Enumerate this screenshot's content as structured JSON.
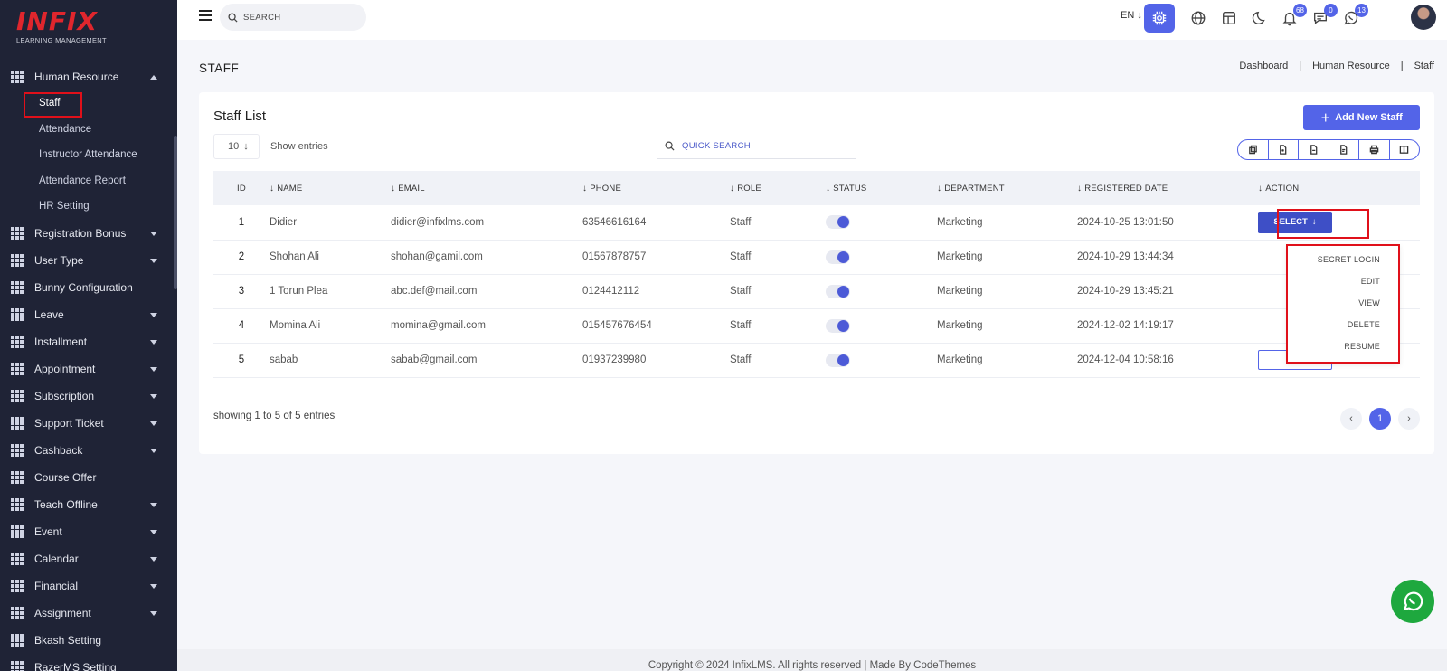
{
  "brand": {
    "logo_text": "INFIX",
    "logo_sub": "LEARNING MANAGEMENT"
  },
  "sidebar": {
    "section": {
      "label": "Human Resource"
    },
    "sub_items": [
      {
        "label": "Staff",
        "active": true
      },
      {
        "label": "Attendance"
      },
      {
        "label": "Instructor Attendance"
      },
      {
        "label": "Attendance Report"
      },
      {
        "label": "HR Setting"
      }
    ],
    "items": [
      {
        "label": "Registration Bonus",
        "caret": true
      },
      {
        "label": "User Type",
        "caret": true
      },
      {
        "label": "Bunny Configuration",
        "caret": false
      },
      {
        "label": "Leave",
        "caret": true
      },
      {
        "label": "Installment",
        "caret": true
      },
      {
        "label": "Appointment",
        "caret": true
      },
      {
        "label": "Subscription",
        "caret": true
      },
      {
        "label": "Support Ticket",
        "caret": true
      },
      {
        "label": "Cashback",
        "caret": true
      },
      {
        "label": "Course Offer",
        "caret": false
      },
      {
        "label": "Teach Offline",
        "caret": true
      },
      {
        "label": "Event",
        "caret": true
      },
      {
        "label": "Calendar",
        "caret": true
      },
      {
        "label": "Financial",
        "caret": true
      },
      {
        "label": "Assignment",
        "caret": true
      },
      {
        "label": "Bkash Setting",
        "caret": false
      },
      {
        "label": "RazerMS Setting",
        "caret": false
      }
    ]
  },
  "header": {
    "search_placeholder": "SEARCH",
    "language": "EN",
    "badges": {
      "notifications": "68",
      "messages": "0",
      "whatsapp": "13"
    }
  },
  "page": {
    "title": "STAFF",
    "breadcrumb": [
      "Dashboard",
      "Human Resource",
      "Staff"
    ]
  },
  "card": {
    "title": "Staff List",
    "add_button": "Add New Staff",
    "entries_value": "10",
    "entries_label": "Show entries",
    "quick_search_placeholder": "QUICK SEARCH"
  },
  "table": {
    "columns": [
      "ID",
      "NAME",
      "EMAIL",
      "PHONE",
      "ROLE",
      "STATUS",
      "DEPARTMENT",
      "REGISTERED DATE",
      "ACTION"
    ],
    "rows": [
      {
        "id": "1",
        "name": "Didier",
        "email": "didier@infixlms.com",
        "phone": "63546616164",
        "role": "Staff",
        "department": "Marketing",
        "date": "2024-10-25 13:01:50"
      },
      {
        "id": "2",
        "name": "Shohan Ali",
        "email": "shohan@gamil.com",
        "phone": "01567878757",
        "role": "Staff",
        "department": "Marketing",
        "date": "2024-10-29 13:44:34"
      },
      {
        "id": "3",
        "name": "1 Torun Plea",
        "email": "abc.def@mail.com",
        "phone": "0124412112",
        "role": "Staff",
        "department": "Marketing",
        "date": "2024-10-29 13:45:21"
      },
      {
        "id": "4",
        "name": "Momina Ali",
        "email": "momina@gmail.com",
        "phone": "015457676454",
        "role": "Staff",
        "department": "Marketing",
        "date": "2024-12-02 14:19:17"
      },
      {
        "id": "5",
        "name": "sabab",
        "email": "sabab@gmail.com",
        "phone": "01937239980",
        "role": "Staff",
        "department": "Marketing",
        "date": "2024-12-04 10:58:16"
      }
    ],
    "select_label": "SELECT"
  },
  "action_menu": [
    "SECRET LOGIN",
    "EDIT",
    "VIEW",
    "DELETE",
    "RESUME"
  ],
  "pagination": {
    "summary": "showing 1 to 5 of 5 entries",
    "current": "1"
  },
  "footer": {
    "text": "Copyright © 2024 InfixLMS. All rights reserved | Made By CodeThemes"
  },
  "colors": {
    "accent": "#5364e8",
    "sidebar": "#1f2336",
    "highlight": "#e0101a",
    "whatsapp": "#1ea83e"
  }
}
